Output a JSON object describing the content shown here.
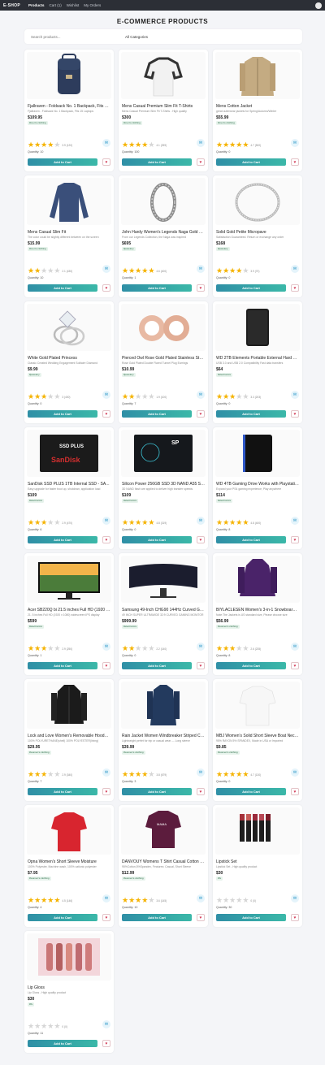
{
  "nav": {
    "brand": "E-SHOP",
    "links": [
      "Products",
      "Cart (1)",
      "Wishlist",
      "My Orders"
    ]
  },
  "page_title": "E-COMMERCE PRODUCTS",
  "filters": {
    "search_placeholder": "Search products...",
    "category_selected": "All Categories"
  },
  "labels": {
    "add_to_cart": "Add to Cart"
  },
  "colors": {
    "star_on": "#f5b301",
    "add_button": "#2f8fa6",
    "heart": "#d43e5a"
  },
  "products": [
    {
      "name": "Fjallraven - Foldsack No. 1 Backpack, Fits 15 Laptops",
      "desc": "Fjallraven - Foldsack No. 1 Backpack, Fits 15 Laptops",
      "price": "$109.95",
      "tag": "#men's clothing",
      "rating": 3.9,
      "rating_text": "3.9 (120)",
      "qty": "Quantity: 10",
      "img": "backpack"
    },
    {
      "name": "Mens Casual Premium Slim Fit T-Shirts",
      "desc": "Mens Casual Premium Slim Fit T-Shirts - High quality",
      "price": "$300",
      "tag": "#men's clothing",
      "rating": 4.1,
      "rating_text": "4.1 (259)",
      "qty": "Quantity: 100",
      "img": "raglan"
    },
    {
      "name": "Mens Cotton Jacket",
      "desc": "great outerwear jackets for Spring/Autumn/Winter",
      "price": "$55.99",
      "tag": "#men's clothing",
      "rating": 4.7,
      "rating_text": "4.7 (500)",
      "qty": "Quantity: 0",
      "img": "jacket"
    },
    {
      "name": "Mens Casual Slim Fit",
      "desc": "The color could be slightly different between on the screen",
      "price": "$15.99",
      "tag": "#men's clothing",
      "rating": 2.1,
      "rating_text": "2.1 (430)",
      "qty": "Quantity: 10",
      "img": "longsleeve"
    },
    {
      "name": "John Hardy Women's Legends Naga Gold & Silver Dragon Bracelet",
      "desc": "From our Legends Collection, the Naga was inspired",
      "price": "$695",
      "tag": "#jewelery",
      "rating": 4.6,
      "rating_text": "4.6 (400)",
      "qty": "Quantity: 1",
      "img": "bracelet"
    },
    {
      "name": "Solid Gold Petite Micropave",
      "desc": "Satisfaction Guaranteed. Return or exchange any order",
      "price": "$168",
      "tag": "#jewelery",
      "rating": 3.9,
      "rating_text": "3.9 (70)",
      "qty": "Quantity: 0",
      "img": "bangle"
    },
    {
      "name": "White Gold Plated Princess",
      "desc": "Classic Created Wedding Engagement Solitaire Diamond",
      "price": "$9.99",
      "tag": "#jewelery",
      "rating": 3,
      "rating_text": "3 (400)",
      "qty": "Quantity: 0",
      "img": "ring"
    },
    {
      "name": "Pierced Owl Rose Gold Plated Stainless Steel Double",
      "desc": "Rose Gold Plated Double Flared Tunnel Plug Earrings",
      "price": "$10.99",
      "tag": "#jewelery",
      "rating": 1.9,
      "rating_text": "1.9 (100)",
      "qty": "Quantity: 7",
      "img": "plugs"
    },
    {
      "name": "WD 2TB Elements Portable External Hard Drive",
      "desc": "USB 3.0 and USB 2.0 Compatibility Fast data transfers",
      "price": "$64",
      "tag": "#electronics",
      "rating": 3.3,
      "rating_text": "3.3 (203)",
      "qty": "Quantity: 0",
      "img": "hdd"
    },
    {
      "name": "SanDisk SSD PLUS 1TB Internal SSD - SATA III 6 Gb/s",
      "desc": "Easy upgrade for faster boot up, shutdown, application load",
      "price": "$109",
      "tag": "#electronics",
      "rating": 2.9,
      "rating_text": "2.9 (470)",
      "qty": "Quantity: 6",
      "img": "ssd_sandisk"
    },
    {
      "name": "Silicon Power 256GB SSD 3D NAND A55 SLC Cache",
      "desc": "3D NAND flash are applied to deliver high transfer speeds",
      "price": "$109",
      "tag": "#electronics",
      "rating": 4.8,
      "rating_text": "4.8 (319)",
      "qty": "Quantity: 0",
      "img": "ssd_sp"
    },
    {
      "name": "WD 4TB Gaming Drive Works with Playstation 4",
      "desc": "Expand your PS4 gaming experience, Play anywhere",
      "price": "$114",
      "tag": "#electronics",
      "rating": 4.8,
      "rating_text": "4.8 (400)",
      "qty": "Quantity: 8",
      "img": "wd_gaming"
    },
    {
      "name": "Acer SB220Q bi 21.5 inches Full HD (1920 x 1080) IPS",
      "desc": "21. 5 inches Full HD (1920 x 1080) widescreen IPS display",
      "price": "$599",
      "tag": "#electronics",
      "rating": 2.9,
      "rating_text": "2.9 (250)",
      "qty": "Quantity: 1",
      "img": "monitor"
    },
    {
      "name": "Samsung 49-Inch CHG90 144Hz Curved Gaming Monitor",
      "desc": "49 INCH SUPER ULTRAWIDE 32:9 CURVED GAMING MONITOR",
      "price": "$999.99",
      "tag": "#electronics",
      "rating": 2.2,
      "rating_text": "2.2 (140)",
      "qty": "Quantity: 0",
      "img": "curved"
    },
    {
      "name": "BIYLACLESEN Women's 3-in-1 Snowboard Jacket Winter Coats",
      "desc": "Note:The Jackets is US standard size, Please choose size",
      "price": "$56.99",
      "tag": "#women's clothing",
      "rating": 2.6,
      "rating_text": "2.6 (235)",
      "qty": "Quantity: 8",
      "img": "snowjacket"
    },
    {
      "name": "Lock and Love Women's Removable Hooded Faux Leather",
      "desc": "100% POLYURETHANE(shell) 100% POLYESTER(lining)",
      "price": "$29.95",
      "tag": "#women's clothing",
      "rating": 2.9,
      "rating_text": "2.9 (340)",
      "qty": "Quantity: 7",
      "img": "leather"
    },
    {
      "name": "Rain Jacket Women Windbreaker Striped Climbing Raincoats",
      "desc": "Lightweight perfet for trip or casual wear --- Long sleeve",
      "price": "$39.99",
      "tag": "#women's clothing",
      "rating": 3.8,
      "rating_text": "3.8 (679)",
      "qty": "Quantity: 3",
      "img": "raincoat"
    },
    {
      "name": "MBJ Women's Solid Short Sleeve Boat Neck V",
      "desc": "95% RAYON 5% SPANDEX, Made in USA or Imported",
      "price": "$9.85",
      "tag": "#women's clothing",
      "rating": 4.7,
      "rating_text": "4.7 (130)",
      "qty": "Quantity: 0",
      "img": "whitetee"
    },
    {
      "name": "Opna Women's Short Sleeve Moisture",
      "desc": "100% Polyester, Machine wash, 100% cationic polyester",
      "price": "$7.95",
      "tag": "#women's clothing",
      "rating": 4.5,
      "rating_text": "4.5 (146)",
      "qty": "Quantity: 4",
      "img": "redtee"
    },
    {
      "name": "DANVOUY Womens T Shirt Casual Cotton Short",
      "desc": "95%Cotton,5%Spandex, Features: Casual, Short Sleeve",
      "price": "$12.99",
      "tag": "#women's clothing",
      "rating": 3.6,
      "rating_text": "3.6 (145)",
      "qty": "Quantity: 10",
      "img": "purpletee"
    },
    {
      "name": "Lipstick Set",
      "desc": "Lipstick Set - High quality product",
      "price": "$30",
      "tag": "#fs",
      "rating": 0,
      "rating_text": "0 (0)",
      "qty": "Quantity: 30",
      "img": "lipstick"
    },
    {
      "name": "Lip Gloss",
      "desc": "Lip Gloss - High quality product",
      "price": "$30",
      "tag": "#fs",
      "rating": 0,
      "rating_text": "0 (0)",
      "qty": "Quantity: 11",
      "img": "lipgloss"
    }
  ]
}
